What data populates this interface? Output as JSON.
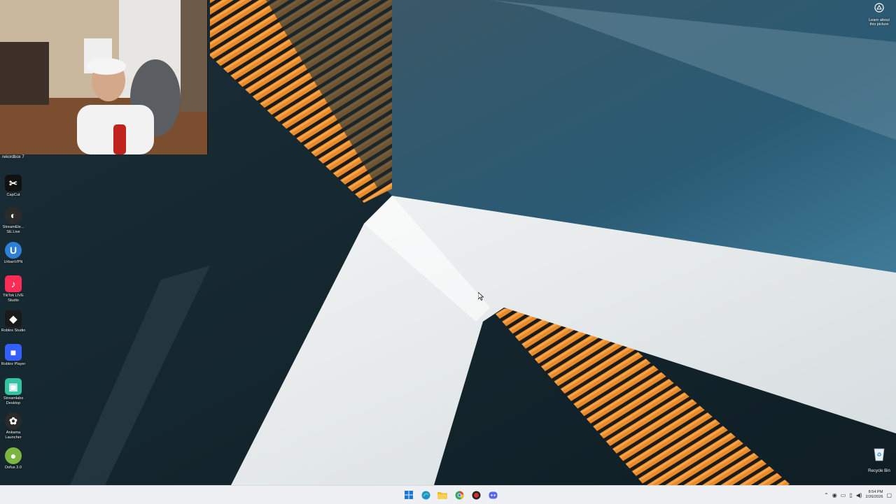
{
  "desktop": {
    "webcam_label": "rekordbox 7",
    "icons": [
      {
        "label": "CapCut",
        "icon": "capcut-icon",
        "color": "#111111"
      },
      {
        "label": "StreamEle... SE.Live",
        "icon": "streamelements-icon",
        "color": "#2b2b2b"
      },
      {
        "label": "UrbanVPN",
        "icon": "urbanvpn-icon",
        "color": "#2d7fd8"
      },
      {
        "label": "TikTok LIVE Studio",
        "icon": "tiktok-live-icon",
        "color": "#fe2c55"
      },
      {
        "label": "Roblox Studio",
        "icon": "roblox-studio-icon",
        "color": "#1a1a1a"
      },
      {
        "label": "Roblox Player",
        "icon": "roblox-player-icon",
        "color": "#335fff"
      },
      {
        "label": "Streamlabs Desktop",
        "icon": "streamlabs-icon",
        "color": "#31c3a2"
      },
      {
        "label": "Ankama Launcher",
        "icon": "ankama-icon",
        "color": "#2a2a2a"
      },
      {
        "label": "Dofus 3.0",
        "icon": "dofus-icon",
        "color": "#7ab640"
      }
    ],
    "recycle_bin_label": "Recycle Bin",
    "learn_line1": "Learn about",
    "learn_line2": "this picture"
  },
  "taskbar": {
    "apps": [
      {
        "icon": "windows-start-icon",
        "color": "#1a78d4"
      },
      {
        "icon": "edge-icon",
        "color": "#1e8fd9"
      },
      {
        "icon": "file-explorer-icon",
        "color": "#f2b928"
      },
      {
        "icon": "chrome-icon",
        "color": "#34a853"
      },
      {
        "icon": "red-app-icon",
        "color": "#d32f2f"
      },
      {
        "icon": "discord-icon",
        "color": "#5865f2"
      }
    ],
    "time": "8:54 PM",
    "date": "2/26/2026"
  }
}
